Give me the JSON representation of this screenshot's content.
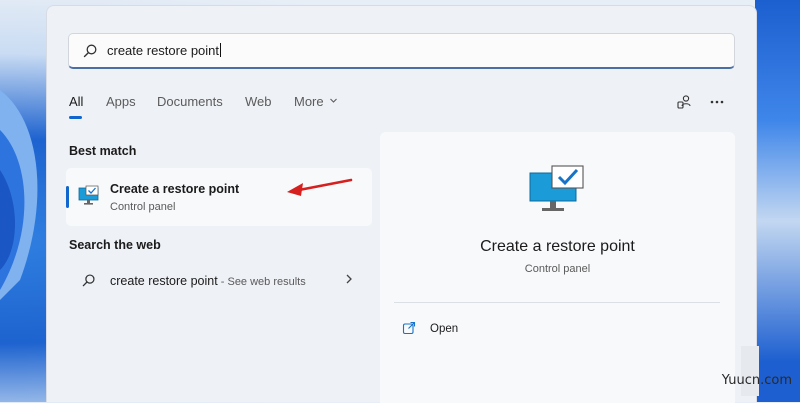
{
  "search": {
    "query": "create restore point"
  },
  "tabs": [
    {
      "label": "All",
      "active": true
    },
    {
      "label": "Apps"
    },
    {
      "label": "Documents"
    },
    {
      "label": "Web"
    },
    {
      "label": "More"
    }
  ],
  "toolbar_icons": [
    "switch-account-icon",
    "more-options-icon"
  ],
  "best_match": {
    "heading": "Best match",
    "title": "Create a restore point",
    "subtitle": "Control panel",
    "icon": "monitor-check-icon"
  },
  "web_search": {
    "heading": "Search the web",
    "query": "create restore point",
    "hint": " - See web results"
  },
  "detail": {
    "title": "Create a restore point",
    "subtitle": "Control panel",
    "actions": [
      {
        "label": "Open",
        "icon": "open-external-icon"
      }
    ]
  },
  "watermark": "Yuucn.com",
  "colors": {
    "accent": "#1066cc",
    "annotation_arrow": "#d61f1f",
    "monitor": "#1b9bd7"
  }
}
